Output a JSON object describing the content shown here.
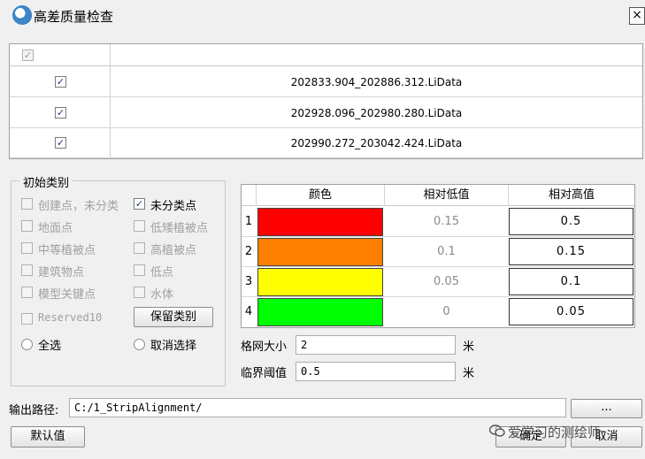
{
  "window": {
    "title": "高差质量检查",
    "close_label": "×"
  },
  "file_table": {
    "header_checked": true,
    "rows": [
      {
        "checked": true,
        "name": "202833.904_202886.312.LiData"
      },
      {
        "checked": true,
        "name": "202928.096_202980.280.LiData"
      },
      {
        "checked": true,
        "name": "202990.272_203042.424.LiData"
      }
    ]
  },
  "initial_classes": {
    "title": "初始类别",
    "items": [
      {
        "label": "创建点，未分类",
        "checked": false,
        "enabled": false
      },
      {
        "label": "未分类点",
        "checked": true,
        "enabled": true
      },
      {
        "label": "地面点",
        "checked": false,
        "enabled": false
      },
      {
        "label": "低矮植被点",
        "checked": false,
        "enabled": false
      },
      {
        "label": "中等植被点",
        "checked": false,
        "enabled": false
      },
      {
        "label": "高植被点",
        "checked": false,
        "enabled": false
      },
      {
        "label": "建筑物点",
        "checked": false,
        "enabled": false
      },
      {
        "label": "低点",
        "checked": false,
        "enabled": false
      },
      {
        "label": "模型关键点",
        "checked": false,
        "enabled": false
      },
      {
        "label": "水体",
        "checked": false,
        "enabled": false
      },
      {
        "label": "Reserved10",
        "checked": false,
        "enabled": false
      }
    ],
    "keep_classes_button": "保留类别",
    "select_all_label": "全选",
    "deselect_label": "取消选择"
  },
  "color_table": {
    "headers": [
      "颜色",
      "相对低值",
      "相对高值"
    ],
    "rows": [
      {
        "index": "1",
        "color": "#ff0000",
        "low": "0.15",
        "high": "0.5"
      },
      {
        "index": "2",
        "color": "#ff7f00",
        "low": "0.1",
        "high": "0.15"
      },
      {
        "index": "3",
        "color": "#ffff00",
        "low": "0.05",
        "high": "0.1"
      },
      {
        "index": "4",
        "color": "#00ff00",
        "low": "0",
        "high": "0.05"
      }
    ]
  },
  "grid_size": {
    "label": "格网大小",
    "value": "2",
    "unit": "米"
  },
  "threshold": {
    "label": "临界阈值",
    "value": "0.5",
    "unit": "米"
  },
  "output_path": {
    "label": "输出路径:",
    "value": "C:/1_StripAlignment/",
    "browse_label": "..."
  },
  "buttons": {
    "defaults": "默认值",
    "ok": "确定",
    "cancel": "取消"
  },
  "watermark": {
    "text": "爱学习的测绘师"
  }
}
